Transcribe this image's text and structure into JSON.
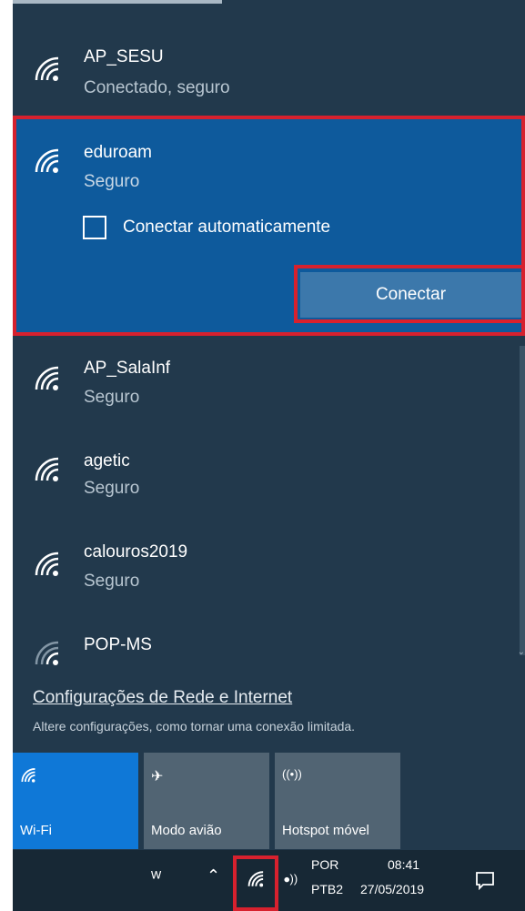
{
  "networks": [
    {
      "name": "AP_SESU",
      "status": "Conectado, seguro",
      "icon": "wifi-icon"
    },
    {
      "name": "eduroam",
      "status": "Seguro",
      "icon": "wifi-icon"
    },
    {
      "name": "AP_SalaInf",
      "status": "Seguro",
      "icon": "wifi-icon"
    },
    {
      "name": "agetic",
      "status": "Seguro",
      "icon": "wifi-icon"
    },
    {
      "name": "calouros2019",
      "status": "Seguro",
      "icon": "wifi-icon"
    },
    {
      "name": "POP-MS",
      "status": "",
      "icon": "wifi-weak-icon"
    }
  ],
  "expanded": {
    "auto_connect_label": "Conectar automaticamente",
    "auto_connect_checked": false,
    "connect_label": "Conectar"
  },
  "settings": {
    "link": "Configurações de Rede e Internet",
    "subtitle": "Altere configurações, como tornar uma conexão limitada."
  },
  "quick_actions": [
    {
      "label": "Wi-Fi",
      "icon": "wifi-icon",
      "active": true
    },
    {
      "label": "Modo avião",
      "icon": "airplane-icon",
      "active": false
    },
    {
      "label": "Hotspot móvel",
      "icon": "hotspot-icon",
      "active": false
    }
  ],
  "taskbar": {
    "lang_top": "POR",
    "lang_bottom": "PTB2",
    "time": "08:41",
    "date": "27/05/2019"
  },
  "colors": {
    "panel": "#22394c",
    "selected": "#0e5a9c",
    "accent": "#0f78d7",
    "highlight_border": "#d7212e"
  }
}
